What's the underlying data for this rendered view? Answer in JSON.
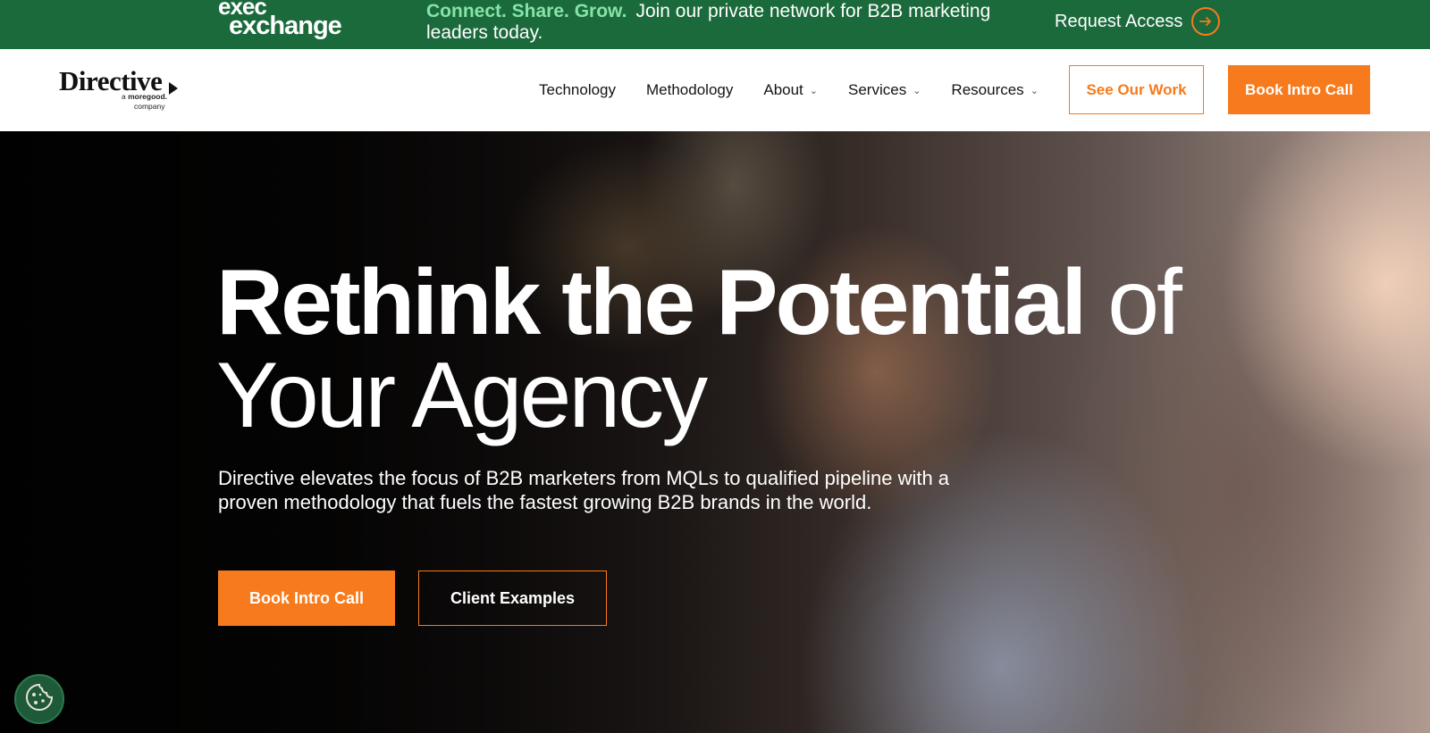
{
  "banner": {
    "logo_line1": "exec",
    "logo_line2": "exchange",
    "tagline": "Connect. Share. Grow.",
    "message": "Join our private network for B2B marketing leaders today.",
    "cta_label": "Request Access"
  },
  "nav": {
    "brand_name": "Directive",
    "brand_sub_a": "a",
    "brand_sub_b": "moregood.",
    "brand_sub_c": "company",
    "items": [
      {
        "label": "Technology",
        "dropdown": false
      },
      {
        "label": "Methodology",
        "dropdown": false
      },
      {
        "label": "About",
        "dropdown": true
      },
      {
        "label": "Services",
        "dropdown": true
      },
      {
        "label": "Resources",
        "dropdown": true
      }
    ],
    "see_work_label": "See Our Work",
    "book_call_label": "Book Intro Call"
  },
  "hero": {
    "title_bold": "Rethink the Potential",
    "title_light_1": "of",
    "title_light_2": "Your Agency",
    "subtitle": "Directive elevates the focus of B2B marketers from MQLs to qualified pipeline with a proven methodology that fuels the fastest growing B2B brands in the world.",
    "primary_cta": "Book Intro Call",
    "secondary_cta": "Client Examples"
  },
  "colors": {
    "banner_green": "#1b6a3c",
    "accent_orange": "#f77a1c",
    "tagline_green": "#86e3a8"
  },
  "icons": {
    "request_arrow": "arrow-right-circle-icon",
    "cookie": "cookie-icon",
    "dropdown": "chevron-down-icon"
  }
}
